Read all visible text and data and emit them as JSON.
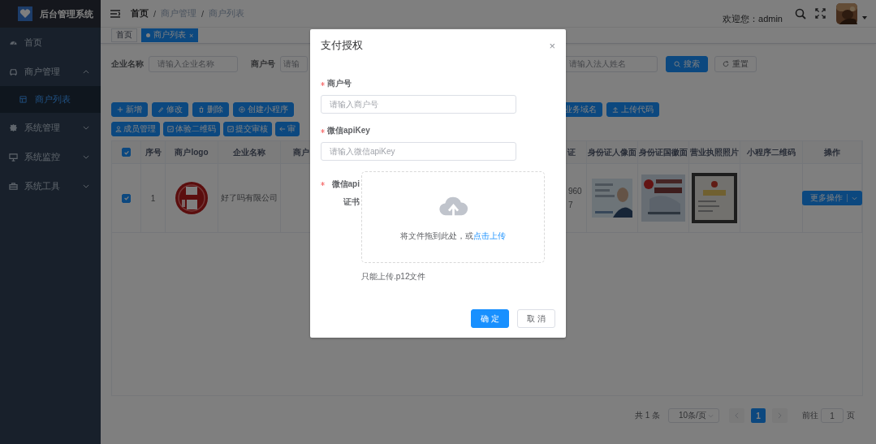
{
  "sidebar": {
    "title": "后台管理系统",
    "items": [
      {
        "label": "首页",
        "kind": "link"
      },
      {
        "label": "商户管理",
        "kind": "group",
        "expanded": true,
        "children": [
          {
            "label": "商户列表",
            "selected": true
          }
        ]
      },
      {
        "label": "系统管理",
        "kind": "group",
        "expanded": false
      },
      {
        "label": "系统监控",
        "kind": "group",
        "expanded": false
      },
      {
        "label": "系统工具",
        "kind": "group",
        "expanded": false
      }
    ]
  },
  "header": {
    "breadcrumb": [
      "首页",
      "商户管理",
      "商户列表"
    ],
    "separator": "/",
    "welcome": "欢迎您：admin"
  },
  "tags": [
    {
      "label": "首页",
      "selected": false
    },
    {
      "label": "商户列表",
      "selected": true,
      "close": "×"
    }
  ],
  "search": {
    "fields": [
      {
        "label": "企业名称",
        "placeholder": "请输入企业名称"
      },
      {
        "label": "商户号",
        "placeholder": "请输"
      }
    ],
    "right_field": {
      "placeholder": "请输入法人姓名"
    },
    "buttons": [
      {
        "label": "搜索",
        "kind": "primary"
      },
      {
        "label": "重置",
        "kind": "default"
      }
    ]
  },
  "toolbar": {
    "row_1_left": [
      "新增",
      "修改",
      "删除",
      "创建小程序"
    ],
    "row_1_right": [
      "业务域名",
      "上传代码"
    ],
    "row_2": [
      "成员管理",
      "体验二维码",
      "提交审核",
      "审"
    ]
  },
  "table": {
    "header_checked": true,
    "columns": [
      "序号",
      "商户logo",
      "企业名称",
      "商户",
      "证",
      "身份证人像面",
      "身份证国徽面",
      "营业执照照片",
      "小程序二维码",
      "操作"
    ],
    "rows": [
      {
        "selected": true,
        "index": "1",
        "company": "好了吗有限公司",
        "cert_tail": [
          "960",
          "7"
        ],
        "action": "更多操作"
      }
    ]
  },
  "pagination": {
    "total": "共 1 条",
    "page_size": "10条/页",
    "pages": [
      {
        "label": "1",
        "selected": true
      }
    ],
    "goto_label": "前往",
    "goto_value": "1",
    "goto_suffix": "页"
  },
  "dialog": {
    "title": "支付授权",
    "close": "×",
    "fields": [
      {
        "kind": "input",
        "label": "商户号",
        "required": true,
        "placeholder": "请输入商户号"
      },
      {
        "kind": "input",
        "label": "微信apiKey",
        "required": true,
        "placeholder": "请输入微信apiKey"
      },
      {
        "kind": "upload",
        "label": "微信api证书",
        "required": true,
        "drop_text": "将文件拖到此处，或",
        "link": "点击上传",
        "hint": "只能上传.p12文件"
      }
    ],
    "buttons": [
      {
        "label": "确 定",
        "kind": "primary"
      },
      {
        "label": "取 消",
        "kind": "default"
      }
    ]
  }
}
